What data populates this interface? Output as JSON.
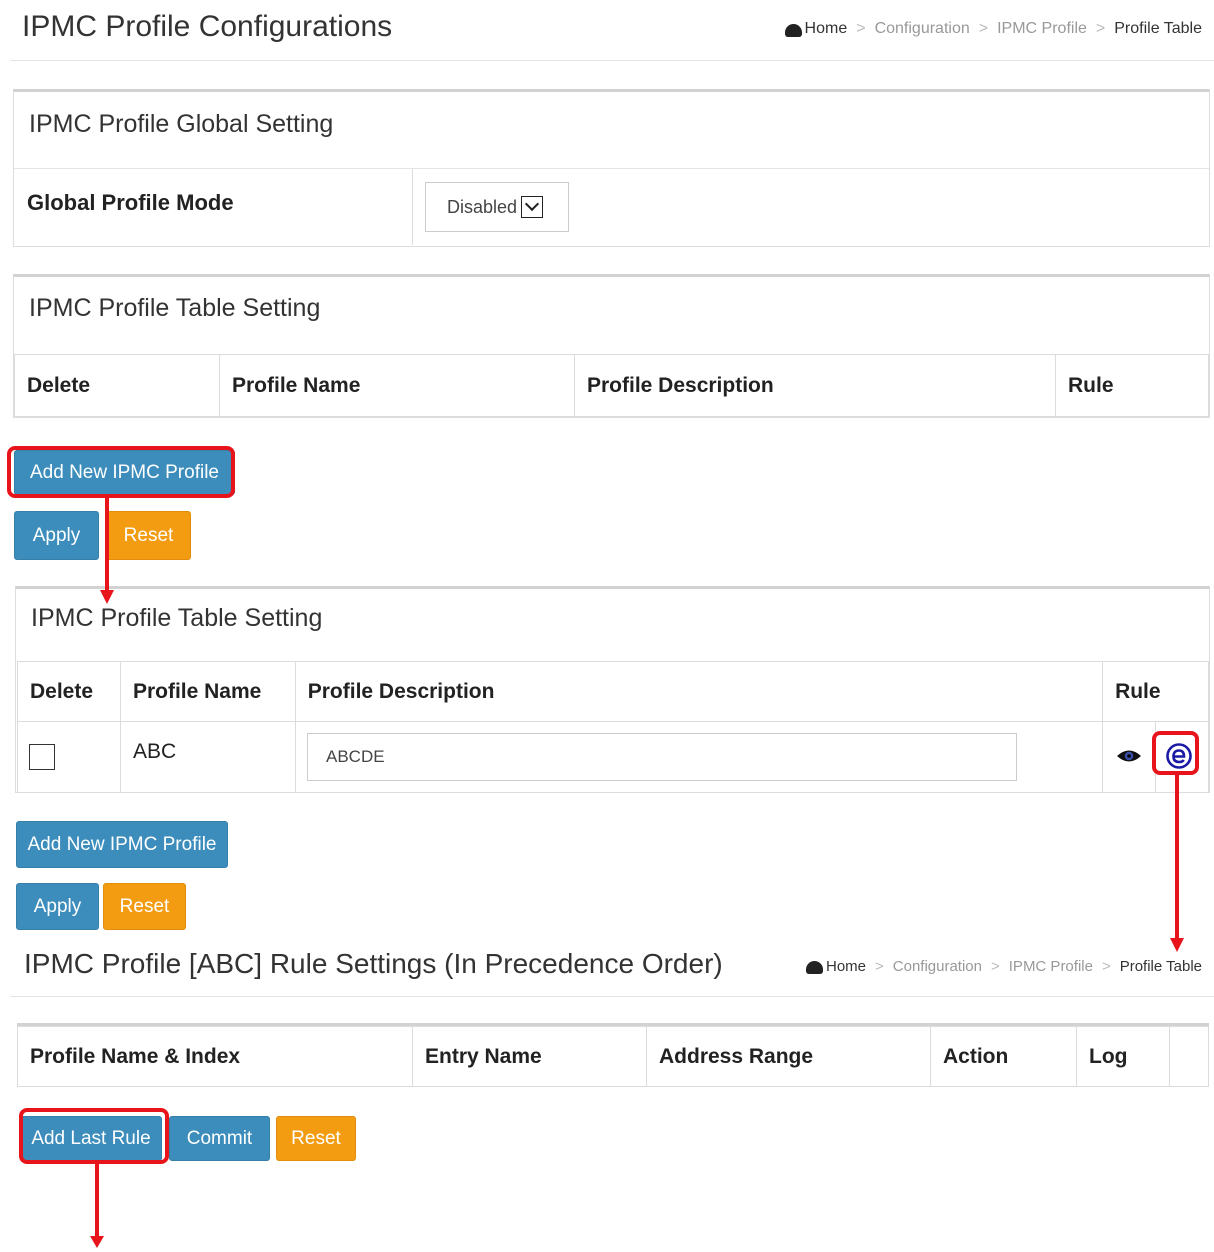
{
  "page": {
    "title": "IPMC Profile Configurations",
    "breadcrumb": [
      "Home",
      "Configuration",
      "IPMC Profile",
      "Profile Table"
    ],
    "breadcrumb_sep": ">"
  },
  "global_setting": {
    "title": "IPMC Profile Global Setting",
    "mode_label": "Global Profile Mode",
    "mode_value": "Disabled"
  },
  "table_empty": {
    "title": "IPMC Profile Table Setting",
    "columns": [
      "Delete",
      "Profile Name",
      "Profile Description",
      "Rule"
    ],
    "add_button": "Add New IPMC Profile",
    "apply_button": "Apply",
    "reset_button": "Reset"
  },
  "table_filled": {
    "title": "IPMC Profile Table Setting",
    "columns": [
      "Delete",
      "Profile Name",
      "Profile Description",
      "Rule"
    ],
    "rows": [
      {
        "profile_name": "ABC",
        "description": "ABCDE",
        "delete_checked": false
      }
    ],
    "add_button": "Add New IPMC Profile",
    "apply_button": "Apply",
    "reset_button": "Reset"
  },
  "rule_settings": {
    "title": "IPMC Profile [ABC] Rule Settings (In Precedence Order)",
    "breadcrumb": [
      "Home",
      "Configuration",
      "IPMC Profile",
      "Profile Table"
    ],
    "breadcrumb_sep": ">",
    "columns": [
      "Profile Name & Index",
      "Entry Name",
      "Address Range",
      "Action",
      "Log"
    ],
    "add_last_rule_button": "Add Last Rule",
    "commit_button": "Commit",
    "reset_button": "Reset"
  },
  "colors": {
    "primary_button": "#3c8dbc",
    "reset_button": "#f39c12",
    "annotation": "#e8141b",
    "edit_icon": "#1a1aa6"
  },
  "icons": {
    "home": "home-icon",
    "view_rule": "eye-icon",
    "edit_rule": "edit-e-icon",
    "select_arrow": "chevron-down-icon"
  }
}
